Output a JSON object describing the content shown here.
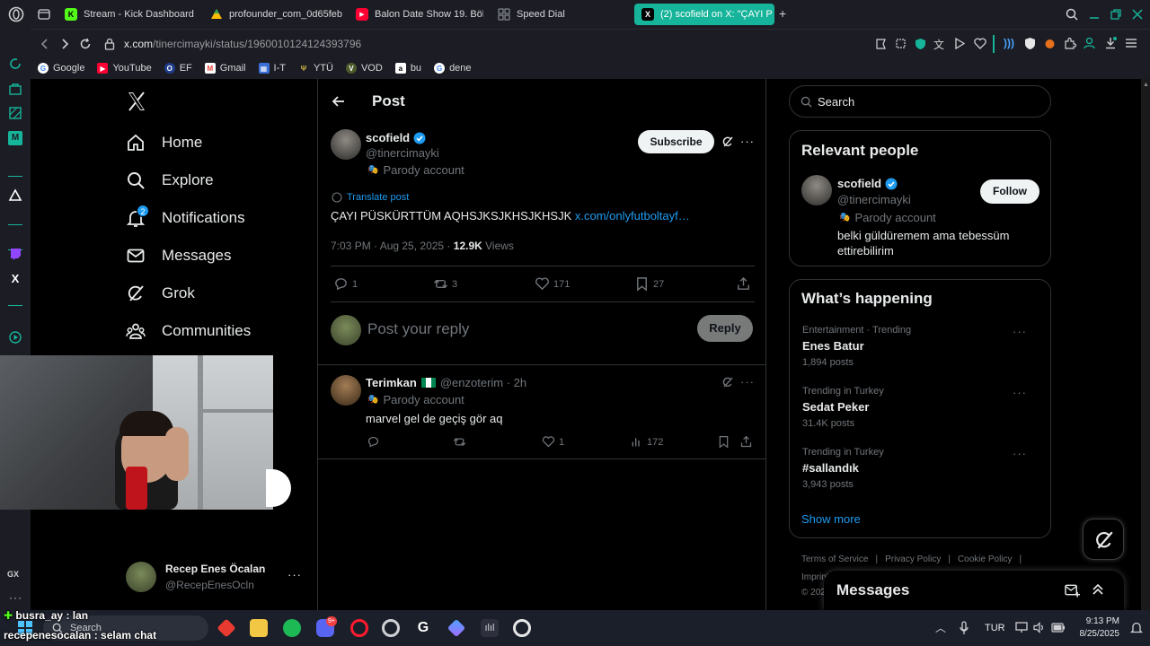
{
  "tabs": [
    {
      "label": "Stream - Kick Dashboard",
      "color": "#53fc18"
    },
    {
      "label": "profounder_com_0d65feb",
      "color": "#4285f4"
    },
    {
      "label": "Balon Date Show 19. Bölü",
      "color": "#ff0033"
    },
    {
      "label": "Speed Dial",
      "color": "#9aa0a6"
    },
    {
      "label": "(2) scofield on X: \"ÇAYI P",
      "color": "#000000"
    }
  ],
  "address": {
    "host": "x.com",
    "path": "/tinercimayki/status/1960010124124393796"
  },
  "bookmarks": [
    "Google",
    "YouTube",
    "EF",
    "Gmail",
    "I-T",
    "YTÜ",
    "VOD",
    "bu",
    "dene"
  ],
  "nav": {
    "items": [
      "Home",
      "Explore",
      "Notifications",
      "Messages",
      "Grok",
      "Communities"
    ],
    "notif_badge": "2",
    "account_name": "Recep Enes Öcalan",
    "account_handle": "@RecepEnesOcln"
  },
  "post_header": {
    "title": "Post"
  },
  "post": {
    "author": "scofield",
    "handle": "@tinercimayki",
    "parody": "Parody account",
    "subscribe_label": "Subscribe",
    "translate": "Translate post",
    "text": "ÇAYI PÜSKÜRTTÜM AQHSJKSJKHSJKHSJK",
    "link": "x.com/onlyfutboltayf…",
    "time": "7:03 PM · Aug 25, 2025 · ",
    "views_count": "12.9K",
    "views_label": " Views",
    "replies": "1",
    "reposts": "3",
    "likes": "171",
    "bookmarks": "27"
  },
  "composer": {
    "placeholder": "Post your reply",
    "reply_label": "Reply"
  },
  "reply": {
    "author": "Terimkan",
    "handle": "@enzoterim · 2h",
    "parody": "Parody account",
    "text": "marvel gel de geçiş gör aq",
    "likes": "1",
    "views": "172"
  },
  "search": {
    "placeholder": "Search"
  },
  "relevant": {
    "title": "Relevant people",
    "name": "scofield",
    "handle": "@tinercimayki",
    "parody": "Parody account",
    "bio": "belki güldüremem ama tebessüm ettirebilirim",
    "follow_label": "Follow"
  },
  "happening": {
    "title": "What’s happening",
    "trends": [
      {
        "category": "Entertainment · Trending",
        "name": "Enes Batur",
        "posts": "1,894 posts"
      },
      {
        "category": "Trending in Turkey",
        "name": "Sedat Peker",
        "posts": "31.4K posts"
      },
      {
        "category": "Trending in Turkey",
        "name": "#sallandık",
        "posts": "3,943 posts"
      }
    ],
    "show_more": "Show more"
  },
  "footer_links": [
    "Terms of Service",
    "Privacy Policy",
    "Cookie Policy",
    "Imprint",
    "© 202"
  ],
  "messages_drawer": {
    "title": "Messages"
  },
  "chat_overlay": [
    {
      "user": "busra_ay",
      "text": " : lan"
    },
    {
      "user": "recepenesocalan",
      "text": " : selam chat"
    }
  ],
  "taskbar": {
    "search_placeholder": "Search",
    "language": "TUR",
    "time": "9:13 PM",
    "date": "8/25/2025",
    "discord_badge": "9+"
  }
}
